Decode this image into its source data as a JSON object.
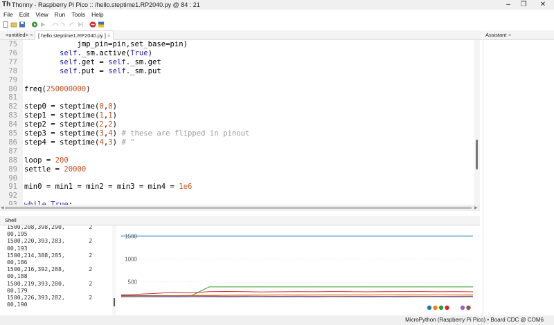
{
  "window": {
    "title": "Thonny  -  Raspberry Pi Pico :: /hello.steptime1.RP2040.py  @  84 : 21",
    "app_icon": "Th"
  },
  "menu": [
    "File",
    "Edit",
    "View",
    "Run",
    "Tools",
    "Help"
  ],
  "toolbar": {
    "icons": [
      "new-file-icon",
      "open-file-icon",
      "save-file-icon",
      "run-icon",
      "debug-icon",
      "step-over-icon",
      "step-into-icon",
      "step-out-icon",
      "resume-icon",
      "stop-icon",
      "flag-icon"
    ],
    "colors": {
      "run": "#2e9c2e",
      "stop": "#d23030",
      "flag_top": "#2f6fcf",
      "flag_bottom": "#f2c200"
    }
  },
  "tabs": {
    "untitled": "<untitled>",
    "active": "[ hello.steptime1.RP2040.py ]",
    "close": "×"
  },
  "assistant": {
    "title": "Assistant",
    "close": "×"
  },
  "editor": {
    "lines": [
      {
        "n": "75",
        "tokens": [
          {
            "t": "            jmp_pin=pin,set_base=pin)",
            "c": ""
          }
        ]
      },
      {
        "n": "76",
        "tokens": [
          {
            "t": "        ",
            "c": ""
          },
          {
            "t": "self",
            "c": "kw"
          },
          {
            "t": "._sm.active(",
            "c": ""
          },
          {
            "t": "True",
            "c": "kw"
          },
          {
            "t": ")",
            "c": ""
          }
        ]
      },
      {
        "n": "77",
        "tokens": [
          {
            "t": "        ",
            "c": ""
          },
          {
            "t": "self",
            "c": "kw"
          },
          {
            "t": ".get = ",
            "c": ""
          },
          {
            "t": "self",
            "c": "kw"
          },
          {
            "t": "._sm.get",
            "c": ""
          }
        ]
      },
      {
        "n": "78",
        "tokens": [
          {
            "t": "        ",
            "c": ""
          },
          {
            "t": "self",
            "c": "kw"
          },
          {
            "t": ".put = ",
            "c": ""
          },
          {
            "t": "self",
            "c": "kw"
          },
          {
            "t": "._sm.put",
            "c": ""
          }
        ]
      },
      {
        "n": "79",
        "tokens": []
      },
      {
        "n": "80",
        "tokens": [
          {
            "t": "freq(",
            "c": ""
          },
          {
            "t": "250000000",
            "c": "num"
          },
          {
            "t": ")",
            "c": ""
          }
        ]
      },
      {
        "n": "81",
        "tokens": []
      },
      {
        "n": "82",
        "tokens": [
          {
            "t": "step0 = steptime(",
            "c": ""
          },
          {
            "t": "0",
            "c": "num"
          },
          {
            "t": ",",
            "c": ""
          },
          {
            "t": "0",
            "c": "num"
          },
          {
            "t": ")",
            "c": ""
          }
        ]
      },
      {
        "n": "83",
        "tokens": [
          {
            "t": "step1 = steptime(",
            "c": ""
          },
          {
            "t": "1",
            "c": "num"
          },
          {
            "t": ",",
            "c": ""
          },
          {
            "t": "1",
            "c": "num"
          },
          {
            "t": ")",
            "c": ""
          }
        ]
      },
      {
        "n": "84",
        "tokens": [
          {
            "t": "step2 = steptime(",
            "c": ""
          },
          {
            "t": "2",
            "c": "num"
          },
          {
            "t": ",",
            "c": ""
          },
          {
            "t": "2",
            "c": "num"
          },
          {
            "t": ")",
            "c": ""
          }
        ]
      },
      {
        "n": "85",
        "tokens": [
          {
            "t": "step3 = steptime(",
            "c": ""
          },
          {
            "t": "3",
            "c": "num"
          },
          {
            "t": ",",
            "c": ""
          },
          {
            "t": "4",
            "c": "num"
          },
          {
            "t": ") ",
            "c": ""
          },
          {
            "t": "# these are flipped in pinout",
            "c": "cmt"
          }
        ]
      },
      {
        "n": "86",
        "tokens": [
          {
            "t": "step4 = steptime(",
            "c": ""
          },
          {
            "t": "4",
            "c": "num"
          },
          {
            "t": ",",
            "c": ""
          },
          {
            "t": "3",
            "c": "num"
          },
          {
            "t": ") ",
            "c": ""
          },
          {
            "t": "# \"",
            "c": "cmt"
          }
        ]
      },
      {
        "n": "87",
        "tokens": []
      },
      {
        "n": "88",
        "tokens": [
          {
            "t": "loop = ",
            "c": ""
          },
          {
            "t": "200",
            "c": "num"
          }
        ]
      },
      {
        "n": "89",
        "tokens": [
          {
            "t": "settle = ",
            "c": ""
          },
          {
            "t": "20000",
            "c": "num"
          }
        ]
      },
      {
        "n": "90",
        "tokens": []
      },
      {
        "n": "91",
        "tokens": [
          {
            "t": "min0 = min1 = min2 = min3 = min4 = ",
            "c": ""
          },
          {
            "t": "1e6",
            "c": "num"
          }
        ]
      },
      {
        "n": "92",
        "tokens": []
      },
      {
        "n": "93",
        "tokens": [
          {
            "t": "while",
            "c": "kw"
          },
          {
            "t": " ",
            "c": ""
          },
          {
            "t": "True",
            "c": "kw"
          },
          {
            "t": ":",
            "c": ""
          }
        ]
      }
    ]
  },
  "shell": {
    "title": "Shell",
    "lines": [
      "1500,208,398,290,       2",
      "00,195",
      "1500,220,393,283,       2",
      "00,193",
      "1500,214,388,285,       2",
      "00,186",
      "1500,216,392,288,       2",
      "00,188",
      "1500,219,393,280,       2",
      "00,179",
      "1500,226,393,282,       2",
      "00,190"
    ]
  },
  "chart_data": {
    "type": "line",
    "yticks": [
      "1500",
      "1000",
      "500"
    ],
    "ylim": [
      -200,
      1700
    ],
    "x": [
      0,
      5,
      10,
      15,
      20,
      25,
      30,
      35,
      40,
      45,
      50,
      55,
      60,
      65,
      70,
      75,
      80,
      85,
      90,
      95,
      100
    ],
    "series": [
      {
        "color": "#1f77b4",
        "values": [
          1500,
          1500,
          1500,
          1500,
          1500,
          1500,
          1500,
          1500,
          1500,
          1500,
          1500,
          1500,
          1500,
          1500,
          1500,
          1500,
          1500,
          1500,
          1500,
          1500,
          1500
        ]
      },
      {
        "color": "#2ca02c",
        "values": [
          200,
          200,
          200,
          200,
          200,
          390,
          390,
          390,
          390,
          390,
          390,
          390,
          390,
          390,
          390,
          390,
          390,
          390,
          390,
          390,
          390
        ]
      },
      {
        "color": "#d62728",
        "values": [
          215,
          230,
          250,
          270,
          260,
          285,
          290,
          285,
          280,
          282,
          286,
          284,
          288,
          285,
          283,
          287,
          285,
          288,
          284,
          286,
          282
        ]
      },
      {
        "color": "#ff7f0e",
        "values": [
          185,
          190,
          195,
          200,
          205,
          205,
          210,
          214,
          216,
          220,
          218,
          220,
          222,
          224,
          222,
          224,
          226,
          224,
          222,
          224,
          226
        ]
      },
      {
        "color": "#8c564b",
        "values": [
          200,
          198,
          195,
          194,
          193,
          192,
          190,
          192,
          190,
          188,
          190,
          188,
          187,
          189,
          188,
          186,
          188,
          187,
          186,
          188,
          190
        ]
      },
      {
        "color": "#9467bd",
        "values": [
          180,
          182,
          183,
          182,
          181,
          180,
          181,
          182,
          180,
          179,
          180,
          181,
          180,
          179,
          180,
          181,
          180,
          179,
          180,
          181,
          180
        ]
      },
      {
        "color": "#7f7f7f",
        "values": [
          170,
          172,
          171,
          170,
          172,
          171,
          170,
          171,
          172,
          170,
          171,
          170,
          172,
          171,
          170,
          171,
          170,
          172,
          171,
          170,
          171
        ]
      }
    ],
    "legend_colors": [
      "#1f77b4",
      "#ff7f0e",
      "#2ca02c",
      "#d62728",
      "#9467bd",
      "#8c564b"
    ]
  },
  "statusbar": {
    "text": "MicroPython (Raspberry Pi Pico)  •  Board CDC @ COM6"
  }
}
